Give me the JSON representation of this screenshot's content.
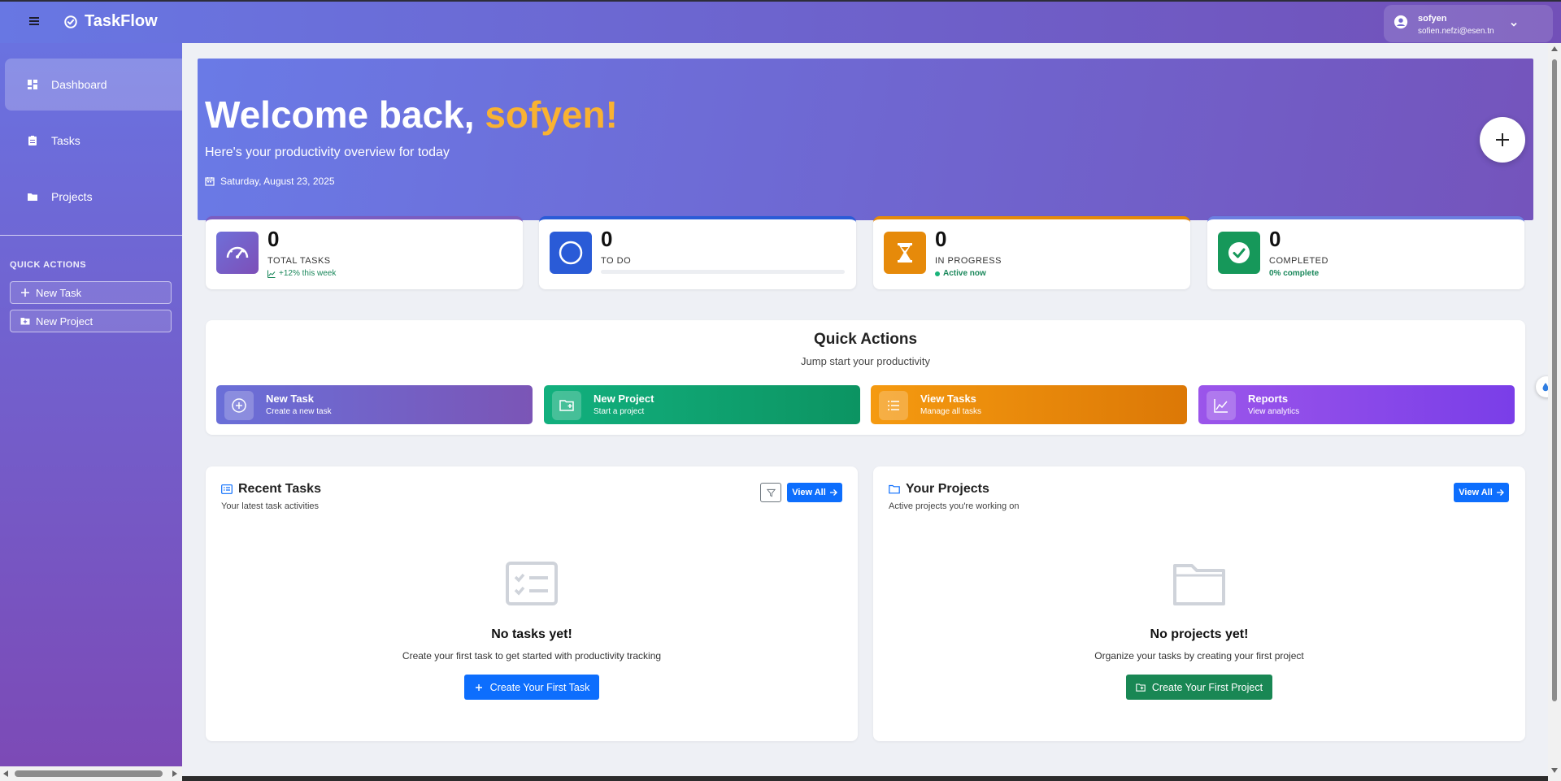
{
  "app": {
    "brand": "TaskFlow"
  },
  "user": {
    "name": "sofyen",
    "email": "sofien.nefzi@esen.tn"
  },
  "sidebar": {
    "items": [
      {
        "label": "Dashboard",
        "icon": "dashboard-icon",
        "active": true
      },
      {
        "label": "Tasks",
        "icon": "clipboard-icon",
        "active": false
      },
      {
        "label": "Projects",
        "icon": "folder-icon",
        "active": false
      }
    ],
    "quick_actions_title": "QUICK ACTIONS",
    "quick_buttons": [
      {
        "label": "New Task",
        "icon": "plus-icon"
      },
      {
        "label": "New Project",
        "icon": "folder-plus-icon"
      }
    ]
  },
  "hero": {
    "title_prefix": "Welcome back, ",
    "title_name": "sofyen!",
    "subtitle": "Here's your productivity overview for today",
    "date": "Saturday, August 23, 2025"
  },
  "stats": [
    {
      "value": "0",
      "label": "TOTAL TASKS",
      "sub": "+12% this week",
      "icon": "speedometer-icon",
      "color": "#7b5cc0"
    },
    {
      "value": "0",
      "label": "TO DO",
      "sub": "",
      "progress": 0,
      "icon": "circle-icon",
      "color": "#2a5bd7"
    },
    {
      "value": "0",
      "label": "IN PROGRESS",
      "sub": "Active now",
      "icon": "hourglass-icon",
      "color": "#e68a0a"
    },
    {
      "value": "0",
      "label": "COMPLETED",
      "sub": "0% complete",
      "icon": "check-circle-icon",
      "color": "#16985a"
    }
  ],
  "quick_actions": {
    "title": "Quick Actions",
    "subtitle": "Jump start your productivity",
    "buttons": [
      {
        "title": "New Task",
        "sub": "Create a new task",
        "icon": "plus-circle-icon"
      },
      {
        "title": "New Project",
        "sub": "Start a project",
        "icon": "folder-plus-icon"
      },
      {
        "title": "View Tasks",
        "sub": "Manage all tasks",
        "icon": "list-icon"
      },
      {
        "title": "Reports",
        "sub": "View analytics",
        "icon": "chart-line-icon"
      }
    ]
  },
  "recent_tasks": {
    "title": "Recent Tasks",
    "subtitle": "Your latest task activities",
    "view_all": "View All",
    "empty_title": "No tasks yet!",
    "empty_sub": "Create your first task to get started with productivity tracking",
    "cta": "Create Your First Task"
  },
  "projects": {
    "title": "Your Projects",
    "subtitle": "Active projects you're working on",
    "view_all": "View All",
    "empty_title": "No projects yet!",
    "empty_sub": "Organize your tasks by creating your first project",
    "cta": "Create Your First Project"
  },
  "colors": {
    "primary": "#0d6efd",
    "success_btn": "#198754",
    "accent_name": "#f9b232"
  }
}
